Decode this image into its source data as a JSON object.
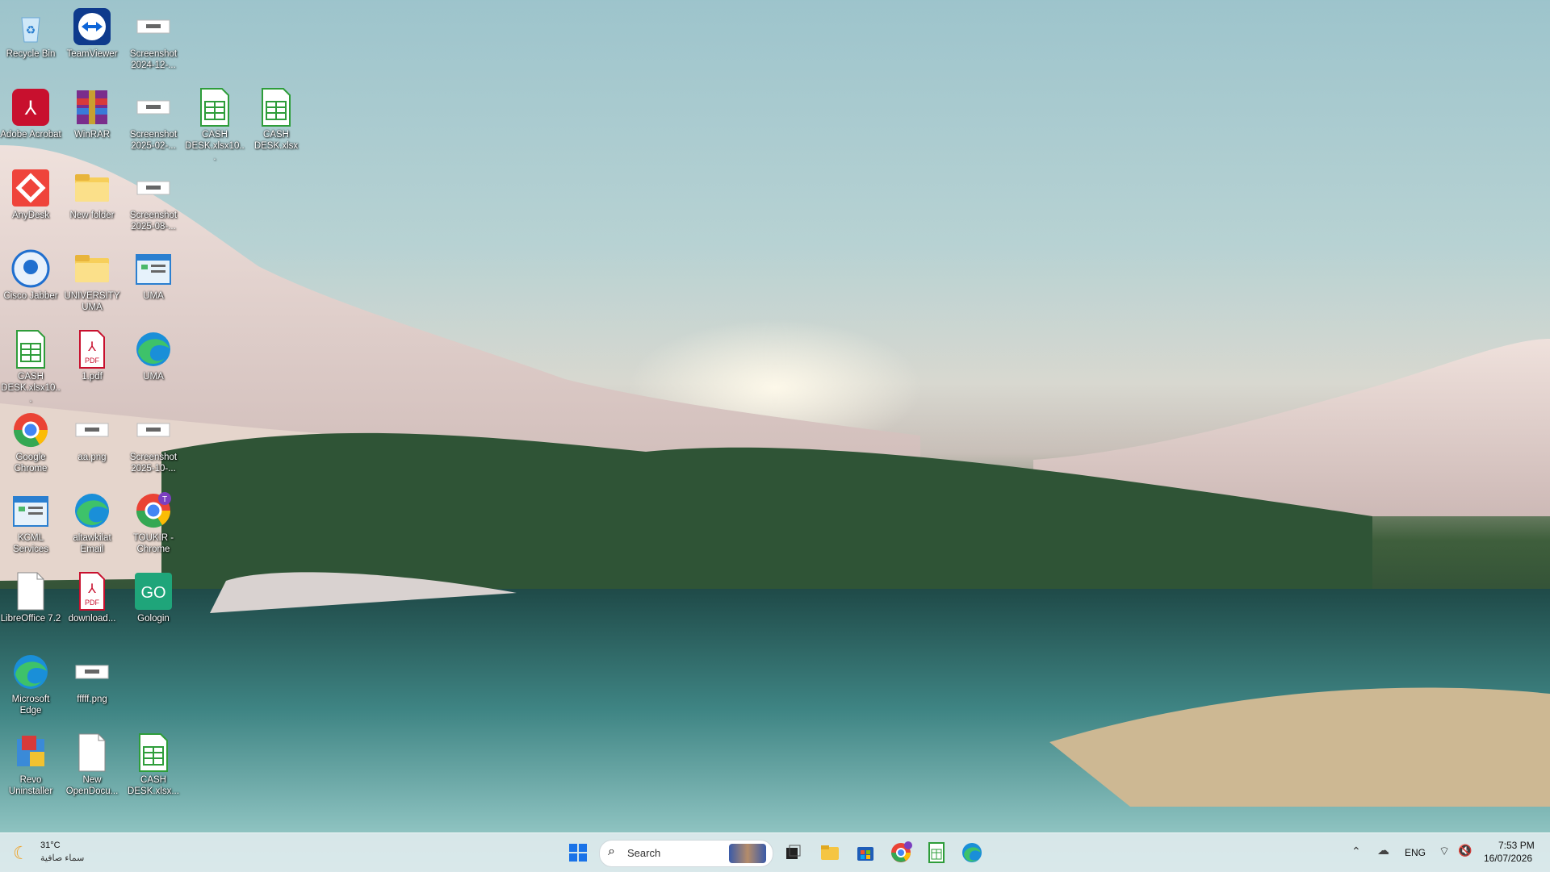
{
  "desktop": {
    "icons": [
      {
        "label": "Recycle Bin",
        "icon": "recycle-bin-icon"
      },
      {
        "label": "TeamViewer",
        "icon": "teamviewer-icon"
      },
      {
        "label": "Screenshot 2024-12-...",
        "icon": "image-file-icon"
      },
      {
        "label": "Adobe Acrobat",
        "icon": "acrobat-icon"
      },
      {
        "label": "WinRAR",
        "icon": "winrar-icon"
      },
      {
        "label": "Screenshot 2025-02-...",
        "icon": "image-file-icon"
      },
      {
        "label": "CASH DESK.xlsx10...",
        "icon": "spreadsheet-icon"
      },
      {
        "label": "CASH DESK.xlsx",
        "icon": "spreadsheet-icon"
      },
      {
        "label": "AnyDesk",
        "icon": "anydesk-icon"
      },
      {
        "label": "New folder",
        "icon": "folder-icon"
      },
      {
        "label": "Screenshot 2025-08-...",
        "icon": "image-file-icon"
      },
      {
        "label": "Cisco Jabber",
        "icon": "cisco-jabber-icon"
      },
      {
        "label": "UNIVERSITY UMA",
        "icon": "folder-icon"
      },
      {
        "label": "UMA",
        "icon": "app-window-icon"
      },
      {
        "label": "CASH DESK.xlsx10...",
        "icon": "spreadsheet-icon"
      },
      {
        "label": "1.pdf",
        "icon": "pdf-icon"
      },
      {
        "label": "UMA",
        "icon": "edge-icon"
      },
      {
        "label": "Google Chrome",
        "icon": "chrome-icon"
      },
      {
        "label": "aa.png",
        "icon": "image-file-icon"
      },
      {
        "label": "Screenshot 2025-10-...",
        "icon": "image-file-icon"
      },
      {
        "label": "KCML Services",
        "icon": "app-window-icon"
      },
      {
        "label": "altawkilat Email",
        "icon": "edge-icon"
      },
      {
        "label": "TOUKIR - Chrome",
        "icon": "chrome-profile-icon"
      },
      {
        "label": "LibreOffice 7.2",
        "icon": "document-icon"
      },
      {
        "label": "download...",
        "icon": "pdf-icon"
      },
      {
        "label": "Gologin",
        "icon": "gologin-icon"
      },
      {
        "label": "Microsoft Edge",
        "icon": "edge-icon"
      },
      {
        "label": "fffff.png",
        "icon": "image-file-icon"
      },
      {
        "label": "Revo Uninstaller",
        "icon": "revo-icon"
      },
      {
        "label": "New OpenDocu...",
        "icon": "document-icon"
      },
      {
        "label": "CASH DESK.xlsx...",
        "icon": "spreadsheet-icon"
      }
    ]
  },
  "taskbar": {
    "weather": {
      "temp": "31°C",
      "condition": "سماء صافية",
      "icon": "moon-icon"
    },
    "search_placeholder": "Search",
    "apps": [
      "start-icon",
      "search-icon",
      "task-view-icon",
      "file-explorer-icon",
      "store-icon",
      "chrome-profile-icon",
      "spreadsheet-icon",
      "edge-icon"
    ],
    "tray": {
      "language": "ENG",
      "time": "7:53 PM",
      "date": "16/07/2026"
    }
  }
}
